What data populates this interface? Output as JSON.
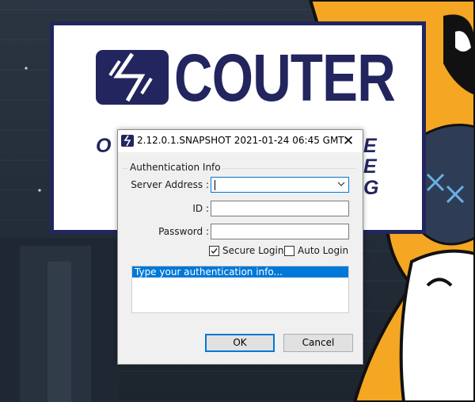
{
  "splash": {
    "brand": "COUTER",
    "tagline_fragments": [
      "O",
      "E",
      "E",
      "G"
    ],
    "brand_color": "#22255e"
  },
  "dialog": {
    "title": "2.12.0.1.SNAPSHOT 2021-01-24 06:45 GMT",
    "app_icon": "scouter-logo-icon",
    "close_label": "✕",
    "group_title": "Authentication Info",
    "server_address_label": "Server Address :",
    "server_address_value": "",
    "id_label": "ID :",
    "id_value": "",
    "password_label": "Password :",
    "password_value": "",
    "secure_login": {
      "label": "Secure Login",
      "checked": true
    },
    "auto_login": {
      "label": "Auto Login",
      "checked": false
    },
    "status_messages": [
      "Type your authentication info..."
    ],
    "ok_label": "OK",
    "cancel_label": "Cancel",
    "accent_color": "#0078d7"
  }
}
